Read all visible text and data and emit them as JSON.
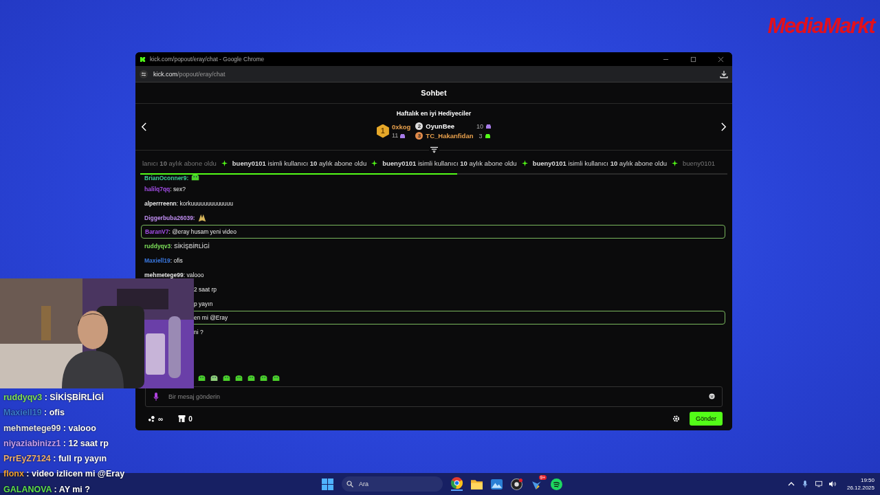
{
  "logo": {
    "text": "MediaMarkt"
  },
  "browser": {
    "title": "kick.com/popout/eray/chat - Google Chrome",
    "url_host": "kick.com",
    "url_path": "/popout/eray/chat"
  },
  "chat": {
    "title": "Sohbet",
    "gifters": {
      "title": "Haftalık en iyi Hediyeciler",
      "leaders": [
        {
          "rank": "1",
          "name": "0xkog",
          "count": "11",
          "color": "#e8a04c"
        },
        {
          "rank": "2",
          "name": "OyunBee",
          "count": "10",
          "color": "#ffffff"
        },
        {
          "rank": "3",
          "name": "TC_Hakanfidan",
          "count": "3",
          "color": "#e8a04c"
        }
      ]
    },
    "ticker": [
      {
        "text": "lanıcı **10** aylık abone oldu",
        "faded": true
      },
      {
        "text": "**bueny0101** isimli kullanıcı **10** aylık abone oldu",
        "faded": false
      },
      {
        "text": "**bueny0101** isimli kullanıcı **10** aylık abone oldu",
        "faded": false
      },
      {
        "text": "**bueny0101** isimli kullanıcı **10** aylık abone oldu",
        "faded": false
      },
      {
        "text": "bueny0101",
        "faded": true
      }
    ],
    "progress": {
      "level": 0.54
    },
    "messages": [
      {
        "kind": "emote",
        "user": "BrianOconner9:",
        "color": "#3fcf9a",
        "highlighted": false
      },
      {
        "kind": "text",
        "user": "halilq7qq",
        "color": "#a24de6",
        "text": ": sex?",
        "highlighted": false
      },
      {
        "kind": "text",
        "user": "alperrreenn",
        "color": "#e4e4e4",
        "text": ": korkuuuuuuuuuuuuu",
        "highlighted": false
      },
      {
        "kind": "emote",
        "user": "Diggerbuba26039:",
        "color": "#c18ef2",
        "highlighted": false
      },
      {
        "kind": "text",
        "user": "BaranV7",
        "color": "#a24de6",
        "text": ": @eray husam yeni video",
        "highlighted": true
      },
      {
        "kind": "text",
        "user": "ruddyqv3",
        "color": "#7de05a",
        "text": ": SİKİŞBİRLİGİ",
        "highlighted": false
      },
      {
        "kind": "text",
        "user": "Maxiell19",
        "color": "#3a78e0",
        "text": ": ofis",
        "highlighted": false
      },
      {
        "kind": "text",
        "user": "mehmetege99",
        "color": "#e4e4e4",
        "text": ": valooo",
        "highlighted": false
      },
      {
        "kind": "partial",
        "text": "2 saat rp",
        "highlighted": false
      },
      {
        "kind": "partial",
        "text": "p yayın",
        "highlighted": false
      },
      {
        "kind": "partial",
        "text": "en mi @Eray",
        "highlighted": true
      },
      {
        "kind": "partial",
        "text": "ni ?",
        "highlighted": false
      },
      {
        "kind": "emotes",
        "highlighted": false
      }
    ],
    "composer": {
      "placeholder": "Bir mesaj gönderin"
    },
    "footer": {
      "points": "∞",
      "shop_count": "0",
      "send": "Gönder"
    }
  },
  "overlay_chat": [
    {
      "user": "ruddyqv3",
      "color": "#7ee05a",
      "text": ": SİKİŞBİRLİGİ"
    },
    {
      "user": "Maxiell19",
      "color": "#3a7bd0",
      "text": ": ofis"
    },
    {
      "user": "mehmetege99",
      "color": "#e6e6e6",
      "text": ": valooo"
    },
    {
      "user": "niyaziabinizz1",
      "color": "#c8a0f0",
      "text": ": 12 saat rp"
    },
    {
      "user": "PrrEyZ7124",
      "color": "#f0b070",
      "text": ": full rp yayın"
    },
    {
      "user": "flonx",
      "color": "#f0a030",
      "text": ": video izlicen mi @Eray"
    },
    {
      "user": "GALANOVA",
      "color": "#5ee04a",
      "text": ": AY mi ?"
    }
  ],
  "taskbar": {
    "search_placeholder": "Ara",
    "badge": "9+",
    "time": "19:50",
    "date": "26.12.2025"
  }
}
